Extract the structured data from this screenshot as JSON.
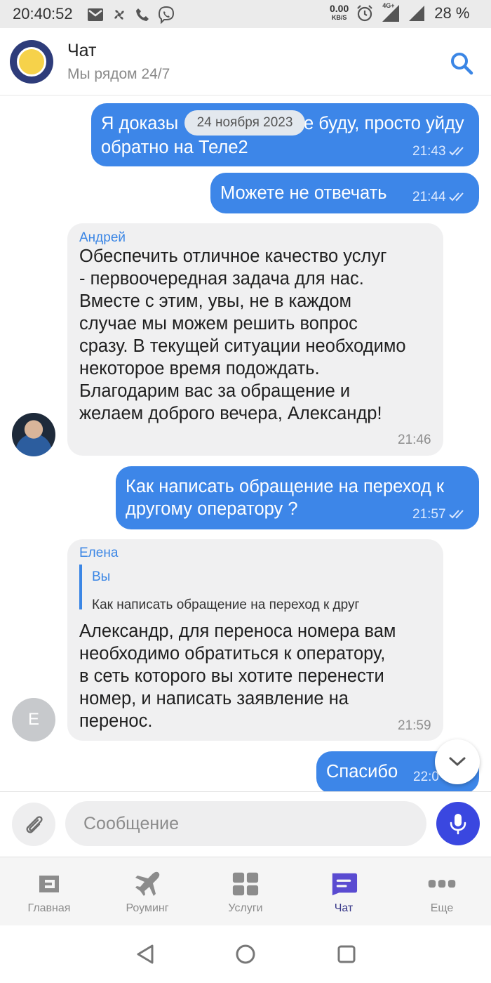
{
  "status_bar": {
    "time": "20:40:52",
    "net_speed": "0.00",
    "net_unit": "KB/S",
    "network": "4G+",
    "battery": "28 %"
  },
  "header": {
    "title": "Чат",
    "subtitle": "Мы рядом 24/7"
  },
  "date_pill": "24 ноября 2023",
  "messages": [
    {
      "direction": "out",
      "lines": [
        "Я доказы",
        "е буду, просто уйду",
        "обратно на Теле2"
      ],
      "time": "21:43"
    },
    {
      "direction": "out",
      "text": "Можете не отвечать",
      "time": "21:44"
    },
    {
      "direction": "in",
      "sender": "Андрей",
      "lines": [
        "Обеспечить отличное качество услуг",
        "- первоочередная задача для нас.",
        "Вместе с этим, увы, не в каждом",
        "случае мы можем решить вопрос",
        "сразу. В текущей ситуации необходимо",
        "некоторое время подождать.",
        "Благодарим вас за обращение и",
        "желаем доброго вечера, Александр!"
      ],
      "time": "21:46"
    },
    {
      "direction": "out",
      "lines": [
        "Как написать обращение на переход к",
        "другому оператору ?"
      ],
      "time": "21:57"
    },
    {
      "direction": "in",
      "sender": "Елена",
      "avatar_letter": "Е",
      "quote_author": "Вы",
      "quote_text": "Как написать обращение на переход к друг",
      "lines": [
        "Александр, для переноса номера вам",
        "необходимо обратиться к оператору,",
        "в сеть которого вы хотите перенести",
        "номер, и написать заявление на",
        "перенос."
      ],
      "time": "21:59"
    },
    {
      "direction": "out",
      "text": "Спасибо",
      "time": "22:0"
    }
  ],
  "input": {
    "placeholder": "Сообщение"
  },
  "bottom_nav": [
    {
      "label": "Главная",
      "icon": "home-card-icon",
      "active": false
    },
    {
      "label": "Роуминг",
      "icon": "airplane-icon",
      "active": false
    },
    {
      "label": "Услуги",
      "icon": "grid-icon",
      "active": false
    },
    {
      "label": "Чат",
      "icon": "chat-icon",
      "active": true
    },
    {
      "label": "Еще",
      "icon": "more-dots-icon",
      "active": false
    }
  ],
  "colors": {
    "outgoing_bubble": "#3d86e8",
    "incoming_bubble": "#f0f0f1",
    "sender_name": "#3b86e5",
    "mic_button": "#3a47e0",
    "active_nav": "#5a4bd1"
  }
}
